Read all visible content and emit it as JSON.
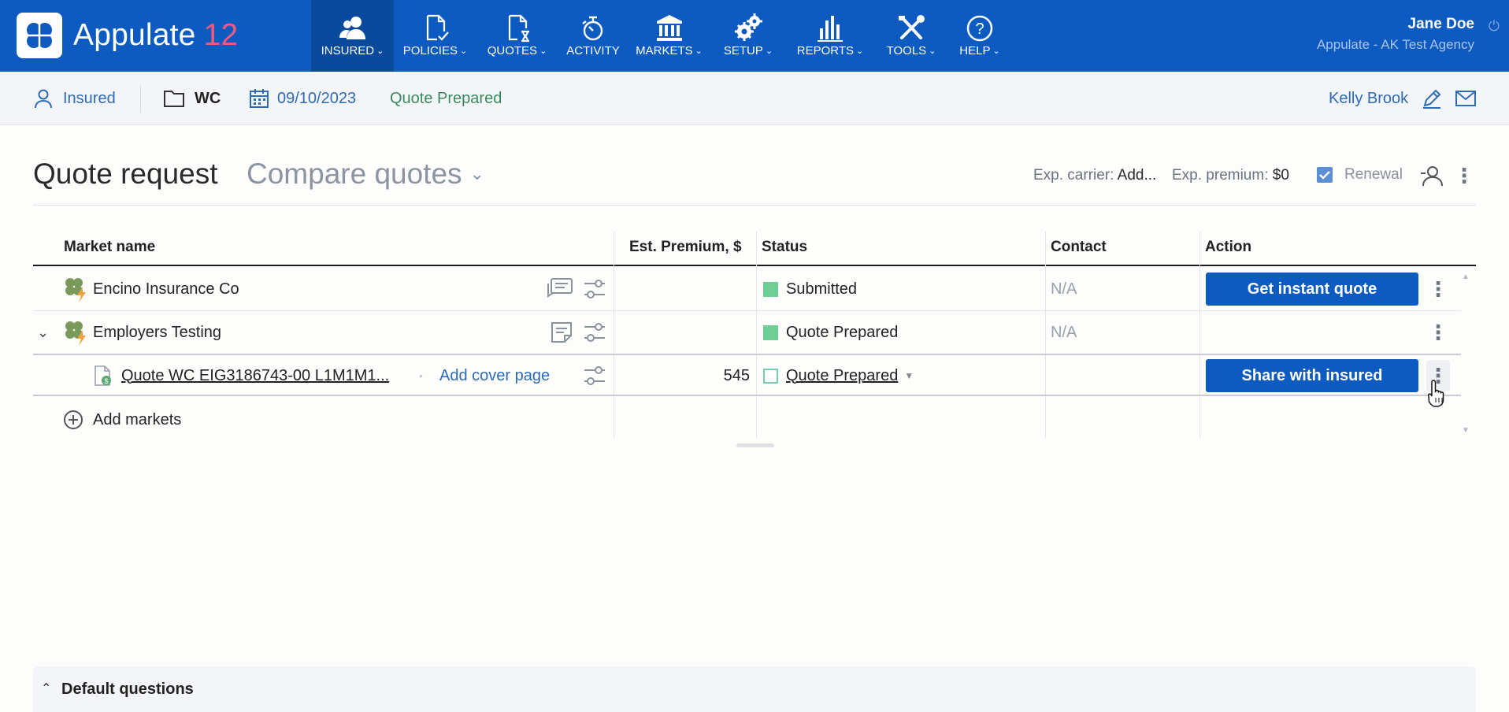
{
  "app": {
    "name": "Appulate",
    "version": "12",
    "brand_color": "#0d5bc1",
    "version_color": "#f25a7c"
  },
  "nav": [
    {
      "label": "INSURED",
      "icon": "insured-icon",
      "active": true
    },
    {
      "label": "POLICIES",
      "icon": "policies-icon"
    },
    {
      "label": "QUOTES",
      "icon": "quotes-icon"
    },
    {
      "label": "ACTIVITY",
      "icon": "activity-icon"
    },
    {
      "label": "MARKETS",
      "icon": "markets-icon"
    },
    {
      "label": "SETUP",
      "icon": "setup-icon"
    },
    {
      "label": "REPORTS",
      "icon": "reports-icon"
    },
    {
      "label": "TOOLS",
      "icon": "tools-icon"
    },
    {
      "label": "HELP",
      "icon": "help-icon"
    }
  ],
  "user": {
    "name": "Jane Doe",
    "agency": "Appulate - AK Test Agency"
  },
  "subheader": {
    "insured": "Insured",
    "line": "WC",
    "date": "09/10/2023",
    "status": "Quote Prepared",
    "contact": "Kelly Brook"
  },
  "page": {
    "title": "Quote request",
    "compare": "Compare quotes",
    "exp_carrier_label": "Exp. carrier:",
    "exp_carrier_value": "Add...",
    "exp_premium_label": "Exp. premium:",
    "exp_premium_value": "$0",
    "renewal_label": "Renewal",
    "renewal_checked": true
  },
  "table": {
    "headers": {
      "market": "Market name",
      "premium": "Est. Premium, $",
      "status": "Status",
      "contact": "Contact",
      "action": "Action"
    },
    "rows": [
      {
        "market": "Encino Insurance Co",
        "premium": "",
        "status": "Submitted",
        "contact": "N/A",
        "action": "Get instant quote"
      },
      {
        "market": "Employers Testing",
        "premium": "",
        "status": "Quote Prepared",
        "contact": "N/A",
        "action": ""
      },
      {
        "market": "Quote WC EIG3186743-00 L1M1M1...",
        "premium": "545",
        "status": "Quote Prepared",
        "contact": "",
        "action": "Share with insured",
        "extra_link": "Add cover page"
      }
    ],
    "add_markets": "Add markets"
  },
  "default_questions": "Default questions"
}
